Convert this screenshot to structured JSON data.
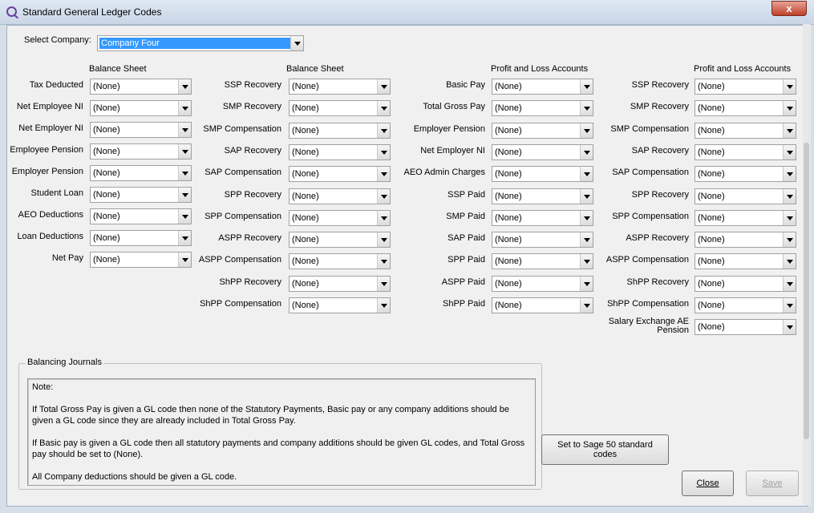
{
  "window": {
    "title": "Standard General Ledger Codes",
    "close_glyph": "x"
  },
  "company": {
    "label": "Select Company:",
    "selected": "Company Four"
  },
  "col1": {
    "header": "Balance Sheet",
    "rows": [
      {
        "label": "Tax Deducted",
        "value": "(None)"
      },
      {
        "label": "Net Employee NI",
        "value": "(None)"
      },
      {
        "label": "Net Employer NI",
        "value": "(None)"
      },
      {
        "label": "Employee Pension",
        "value": "(None)"
      },
      {
        "label": "Employer Pension",
        "value": "(None)"
      },
      {
        "label": "Student Loan",
        "value": "(None)"
      },
      {
        "label": "AEO Deductions",
        "value": "(None)"
      },
      {
        "label": "Loan Deductions",
        "value": "(None)"
      },
      {
        "label": "Net Pay",
        "value": "(None)"
      }
    ]
  },
  "col2": {
    "header": "Balance Sheet",
    "rows": [
      {
        "label": "SSP Recovery",
        "value": "(None)"
      },
      {
        "label": "SMP Recovery",
        "value": "(None)"
      },
      {
        "label": "SMP Compensation",
        "value": "(None)"
      },
      {
        "label": "SAP Recovery",
        "value": "(None)"
      },
      {
        "label": "SAP Compensation",
        "value": "(None)"
      },
      {
        "label": "SPP Recovery",
        "value": "(None)"
      },
      {
        "label": "SPP Compensation",
        "value": "(None)"
      },
      {
        "label": "ASPP Recovery",
        "value": "(None)"
      },
      {
        "label": "ASPP Compensation",
        "value": "(None)"
      },
      {
        "label": "ShPP Recovery",
        "value": "(None)"
      },
      {
        "label": "ShPP Compensation",
        "value": "(None)"
      }
    ]
  },
  "col3": {
    "header": "Profit and Loss Accounts",
    "rows": [
      {
        "label": "Basic Pay",
        "value": "(None)"
      },
      {
        "label": "Total Gross Pay",
        "value": "(None)"
      },
      {
        "label": "Employer Pension",
        "value": "(None)"
      },
      {
        "label": "Net Employer NI",
        "value": "(None)"
      },
      {
        "label": "AEO Admin Charges",
        "value": "(None)"
      },
      {
        "label": "SSP Paid",
        "value": "(None)"
      },
      {
        "label": "SMP Paid",
        "value": "(None)"
      },
      {
        "label": "SAP Paid",
        "value": "(None)"
      },
      {
        "label": "SPP Paid",
        "value": "(None)"
      },
      {
        "label": "ASPP Paid",
        "value": "(None)"
      },
      {
        "label": "ShPP Paid",
        "value": "(None)"
      }
    ]
  },
  "col4": {
    "header": "Profit and Loss Accounts",
    "rows": [
      {
        "label": "SSP Recovery",
        "value": "(None)"
      },
      {
        "label": "SMP Recovery",
        "value": "(None)"
      },
      {
        "label": "SMP Compensation",
        "value": "(None)"
      },
      {
        "label": "SAP Recovery",
        "value": "(None)"
      },
      {
        "label": "SAP Compensation",
        "value": "(None)"
      },
      {
        "label": "SPP Recovery",
        "value": "(None)"
      },
      {
        "label": "SPP Compensation",
        "value": "(None)"
      },
      {
        "label": "ASPP Recovery",
        "value": "(None)"
      },
      {
        "label": "ASPP Compensation",
        "value": "(None)"
      },
      {
        "label": "ShPP Recovery",
        "value": "(None)"
      },
      {
        "label": "ShPP Compensation",
        "value": "(None)"
      },
      {
        "label": "Salary Exchange AE",
        "label2": "Pension",
        "value": "(None)"
      }
    ]
  },
  "journals": {
    "title": "Balancing Journals",
    "note_heading": "Note:",
    "para1": "If Total Gross Pay is given a GL code then none of the Statutory Payments, Basic pay or any company additions should be given a GL code since they are already included in Total Gross Pay.",
    "para2": "If Basic pay is given a GL code then all statutory payments and company additions should be given GL codes, and Total Gross pay should be set to (None).",
    "para3": "All Company deductions should be given a GL code."
  },
  "buttons": {
    "sage_line1": "Set to Sage 50 standard",
    "sage_line2": "codes",
    "close": "Close",
    "save": "Save"
  }
}
